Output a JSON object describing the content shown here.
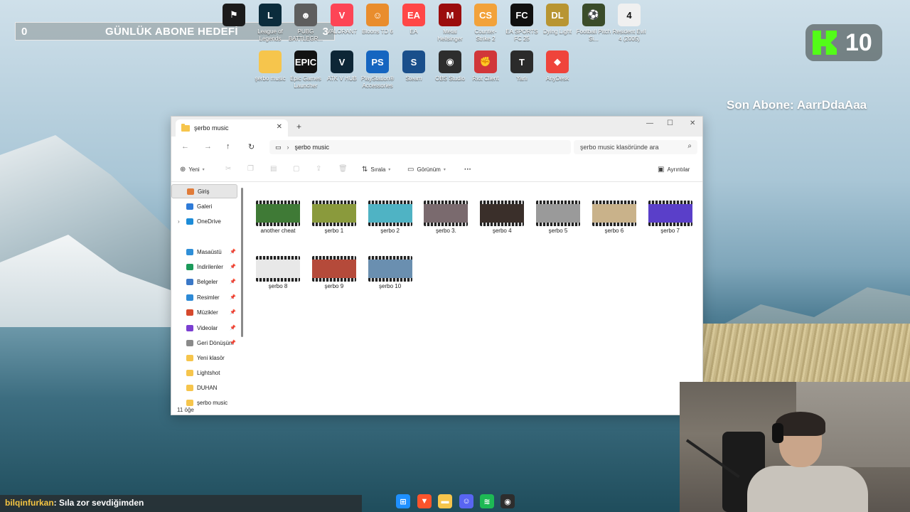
{
  "overlay": {
    "goal_current": "0",
    "goal_title": "GÜNLÜK ABONE HEDEFİ",
    "goal_target": "3",
    "kick_count": "10",
    "last_sub": "Son Abone: AarrDdaAaa"
  },
  "desktop_icons": [
    {
      "label": "",
      "icon": "app-icon",
      "color": "#1b1b1b",
      "glyph": "⚑"
    },
    {
      "label": "League of Legends",
      "icon": "league-of-legends-icon",
      "color": "#0b2c3c",
      "glyph": "L"
    },
    {
      "label": "PUBG BATTLEGR...",
      "icon": "pubg-icon",
      "color": "#5e5e5e",
      "glyph": "☻"
    },
    {
      "label": "VALORANT",
      "icon": "valorant-icon",
      "color": "#fd4556",
      "glyph": "V"
    },
    {
      "label": "Bloons TD 6",
      "icon": "bloons-icon",
      "color": "#e98d2d",
      "glyph": "☺"
    },
    {
      "label": "EA",
      "icon": "ea-icon",
      "color": "#ff4747",
      "glyph": "EA"
    },
    {
      "label": "Metal Hellsinger",
      "icon": "metal-hellsinger-icon",
      "color": "#9b0d0d",
      "glyph": "M"
    },
    {
      "label": "Counter-Strike 2",
      "icon": "counter-strike-icon",
      "color": "#f2a23a",
      "glyph": "CS"
    },
    {
      "label": "EA SPORTS FC 25",
      "icon": "ea-fc-icon",
      "color": "#101010",
      "glyph": "FC"
    },
    {
      "label": "Dying Light",
      "icon": "dying-light-icon",
      "color": "#b89532",
      "glyph": "DL"
    },
    {
      "label": "Football Pitch Si...",
      "icon": "football-icon",
      "color": "#3a4c2a",
      "glyph": "⚽"
    },
    {
      "label": "Resident Evil 4 (2005)",
      "icon": "resident-evil-icon",
      "color": "#f0f0f0",
      "glyph": "4"
    },
    {
      "label": "şerbo music",
      "icon": "folder-icon",
      "color": "#f6c54c",
      "glyph": ""
    },
    {
      "label": "Epic Games Launcher",
      "icon": "epic-games-icon",
      "color": "#121212",
      "glyph": "EPIC"
    },
    {
      "label": "ATK V HUB",
      "icon": "atk-hub-icon",
      "color": "#0d2636",
      "glyph": "V"
    },
    {
      "label": "PlayStation® Accessories",
      "icon": "playstation-icon",
      "color": "#1565c0",
      "glyph": "PS"
    },
    {
      "label": "Steam",
      "icon": "steam-icon",
      "color": "#1a4f8b",
      "glyph": "S"
    },
    {
      "label": "OBS Studio",
      "icon": "obs-icon",
      "color": "#2d2d2d",
      "glyph": "◉"
    },
    {
      "label": "Riot Client",
      "icon": "riot-client-icon",
      "color": "#d13639",
      "glyph": "✊"
    },
    {
      "label": "Yarlı",
      "icon": "yarli-icon",
      "color": "#2b2b2b",
      "glyph": "T"
    },
    {
      "label": "AnyDesk",
      "icon": "anydesk-icon",
      "color": "#ef443b",
      "glyph": "◆"
    }
  ],
  "explorer": {
    "tab_title": "şerbo music",
    "address": "şerbo music",
    "search_placeholder": "şerbo music klasöründe ara",
    "toolbar": {
      "new": "Yeni",
      "sort": "Sırala",
      "view": "Görünüm",
      "more": "···",
      "details": "Ayrıntılar"
    },
    "sidebar": [
      {
        "label": "Giriş",
        "icon": "home-icon",
        "color": "#e07b39",
        "pinned": false,
        "active": true
      },
      {
        "label": "Galeri",
        "icon": "gallery-icon",
        "color": "#2f7bd8",
        "pinned": false,
        "active": false
      },
      {
        "label": "OneDrive",
        "icon": "onedrive-icon",
        "color": "#1d8cd8",
        "pinned": false,
        "active": false
      },
      {
        "label": "Masaüstü",
        "icon": "desktop-icon",
        "color": "#2f8fd8",
        "pinned": true,
        "active": false
      },
      {
        "label": "İndirilenler",
        "icon": "downloads-icon",
        "color": "#1b9a5a",
        "pinned": true,
        "active": false
      },
      {
        "label": "Belgeler",
        "icon": "documents-icon",
        "color": "#3b78c7",
        "pinned": true,
        "active": false
      },
      {
        "label": "Resimler",
        "icon": "pictures-icon",
        "color": "#2d8ad6",
        "pinned": true,
        "active": false
      },
      {
        "label": "Müzikler",
        "icon": "music-icon",
        "color": "#d6492d",
        "pinned": true,
        "active": false
      },
      {
        "label": "Videolar",
        "icon": "videos-icon",
        "color": "#7b3fd1",
        "pinned": true,
        "active": false
      },
      {
        "label": "Geri Dönüşüm",
        "icon": "recycle-bin-icon",
        "color": "#8a8a8a",
        "pinned": true,
        "active": false
      },
      {
        "label": "Yeni klasör",
        "icon": "folder-icon",
        "color": "#f6c54c",
        "pinned": false,
        "active": false
      },
      {
        "label": "Lightshot",
        "icon": "folder-icon",
        "color": "#f6c54c",
        "pinned": false,
        "active": false
      },
      {
        "label": "DUHAN",
        "icon": "folder-icon",
        "color": "#f6c54c",
        "pinned": false,
        "active": false
      },
      {
        "label": "şerbo music",
        "icon": "folder-icon",
        "color": "#f6c54c",
        "pinned": false,
        "active": false
      }
    ],
    "files": [
      {
        "name": "another cheat",
        "color": "#3f7a36"
      },
      {
        "name": "şerbo 1",
        "color": "#8a9a3c"
      },
      {
        "name": "şerbo 2",
        "color": "#4fb3c4"
      },
      {
        "name": "şerbo 3.",
        "color": "#7a6a6e"
      },
      {
        "name": "şerbo 4",
        "color": "#3a2f2a"
      },
      {
        "name": "şerbo 5",
        "color": "#9a9a9a"
      },
      {
        "name": "şerbo 6",
        "color": "#c9b28a"
      },
      {
        "name": "şerbo 7",
        "color": "#5a3fc9"
      },
      {
        "name": "şerbo 8",
        "color": "#e8e8e8"
      },
      {
        "name": "şerbo 9",
        "color": "#b54a3a"
      },
      {
        "name": "şerbo 10",
        "color": "#6a8fb0"
      }
    ],
    "status": "11 öğe"
  },
  "chat": {
    "user": "bilqinfurkan",
    "message": ": Sıla zor sevdiğimden"
  },
  "taskbar": [
    {
      "icon": "windows-start-icon",
      "color": "#1e90ff",
      "glyph": "⊞"
    },
    {
      "icon": "brave-browser-icon",
      "color": "#fb542b",
      "glyph": "▼"
    },
    {
      "icon": "file-explorer-icon",
      "color": "#f6c54c",
      "glyph": "▬"
    },
    {
      "icon": "discord-icon",
      "color": "#5865f2",
      "glyph": "☺"
    },
    {
      "icon": "spotify-icon",
      "color": "#1db954",
      "glyph": "≋"
    },
    {
      "icon": "obs-icon",
      "color": "#2d2d2d",
      "glyph": "◉"
    }
  ]
}
